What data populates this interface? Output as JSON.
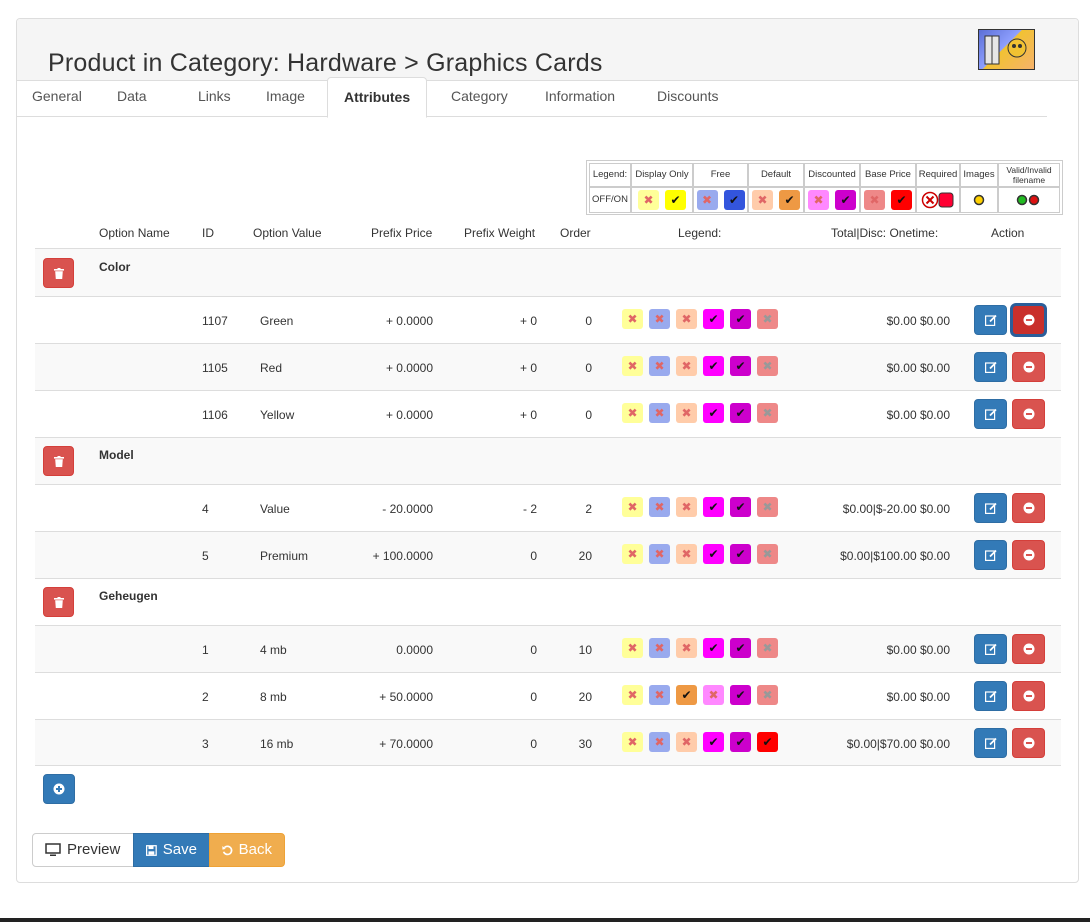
{
  "page": {
    "title": "Product in Category: Hardware > Graphics Cards"
  },
  "tabs": [
    {
      "label": "General"
    },
    {
      "label": "Data"
    },
    {
      "label": "Links"
    },
    {
      "label": "Image"
    },
    {
      "label": "Attributes",
      "active": true
    },
    {
      "label": "Category"
    },
    {
      "label": "Information"
    },
    {
      "label": "Discounts"
    }
  ],
  "legend": {
    "row_label": "Legend:",
    "offon_label": "OFF/ON",
    "columns": [
      "Display Only",
      "Free",
      "Default",
      "Discounted",
      "Base Price",
      "Required",
      "Images",
      "Valid/Invalid filename"
    ]
  },
  "colors": {
    "display_only_off": "#ffff99",
    "display_only_on": "#ffff00",
    "free_off": "#99aaee",
    "free_on": "#3355dd",
    "default_off": "#ffccaa",
    "default_on": "#ee9944",
    "discounted_off": "#ff88ff",
    "discounted_on": "#ff00ff",
    "base_price_off": "#ee8888",
    "base_price_on": "#ff0000",
    "purple_on": "#cc00cc"
  },
  "table": {
    "headers": {
      "option_name": "Option Name",
      "id": "ID",
      "option_value": "Option Value",
      "prefix_price": "Prefix Price",
      "prefix_weight": "Prefix Weight",
      "order": "Order",
      "legend": "Legend:",
      "total": "Total|Disc: Onetime:",
      "action": "Action"
    },
    "groups": [
      {
        "name": "Color",
        "rows": [
          {
            "id": "1107",
            "value": "Green",
            "price": "+ 0.0000",
            "weight": "+ 0",
            "order": "0",
            "total": "$0.00 $0.00"
          },
          {
            "id": "1105",
            "value": "Red",
            "price": "+ 0.0000",
            "weight": "+ 0",
            "order": "0",
            "total": "$0.00 $0.00"
          },
          {
            "id": "1106",
            "value": "Yellow",
            "price": "+ 0.0000",
            "weight": "+ 0",
            "order": "0",
            "total": "$0.00 $0.00"
          }
        ]
      },
      {
        "name": "Model",
        "rows": [
          {
            "id": "4",
            "value": "Value",
            "price": "- 20.0000",
            "weight": "- 2",
            "order": "2",
            "total": "$0.00|$-20.00 $0.00"
          },
          {
            "id": "5",
            "value": "Premium",
            "price": "+ 100.0000",
            "weight": "0",
            "order": "20",
            "total": "$0.00|$100.00 $0.00"
          }
        ]
      },
      {
        "name": "Geheugen",
        "rows": [
          {
            "id": "1",
            "value": "4 mb",
            "price": "0.0000",
            "weight": "0",
            "order": "10",
            "total": "$0.00 $0.00"
          },
          {
            "id": "2",
            "value": "8 mb",
            "price": "+ 50.0000",
            "weight": "0",
            "order": "20",
            "total": "$0.00 $0.00"
          },
          {
            "id": "3",
            "value": "16 mb",
            "price": "+ 70.0000",
            "weight": "0",
            "order": "30",
            "total": "$0.00|$70.00 $0.00"
          }
        ]
      }
    ]
  },
  "footer": {
    "preview": "Preview",
    "save": "Save",
    "back": "Back"
  }
}
